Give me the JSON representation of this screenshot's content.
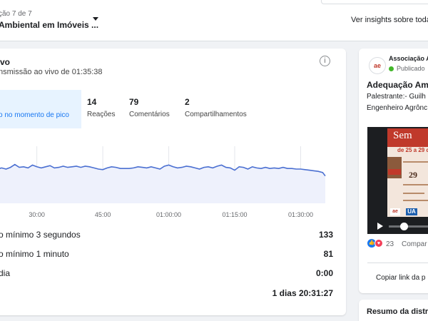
{
  "header": {
    "subtitle": "ção 7 de 7",
    "title": "Ambiental em Imóveis ...",
    "insights_link": "Ver insights sobre toda"
  },
  "live": {
    "title": "vo",
    "subtitle": "nsmissão ao vivo de 01:35:38",
    "peak_label": "o no momento de pico",
    "stats": [
      {
        "value": "14",
        "label": "Reações"
      },
      {
        "value": "79",
        "label": "Comentários"
      },
      {
        "value": "2",
        "label": "Compartilhamentos"
      }
    ],
    "chart_data": {
      "type": "area",
      "x_tick_labels": [
        "30:00",
        "45:00",
        "01:00:00",
        "01:15:00",
        "01:30:00"
      ],
      "x_ticks_minutes": [
        30,
        45,
        60,
        75,
        90
      ],
      "x_range_minutes": [
        20,
        95.6
      ],
      "y_range": [
        0,
        100
      ],
      "series": [
        {
          "x": [
            20,
            21,
            22,
            23,
            24,
            25,
            26,
            27,
            28,
            29,
            30,
            31,
            32,
            33,
            34,
            35,
            36,
            37,
            38,
            39,
            40,
            41,
            42,
            43,
            44,
            45,
            46,
            47,
            48,
            49,
            50,
            51,
            52,
            53,
            54,
            55,
            56,
            57,
            58,
            59,
            60,
            61,
            62,
            63,
            64,
            65,
            66,
            67,
            68,
            69,
            70,
            71,
            72,
            73,
            74,
            75,
            76,
            77,
            78,
            79,
            80,
            81,
            82,
            83,
            84,
            85,
            86,
            87,
            88,
            89,
            90,
            91,
            92,
            93,
            94,
            95,
            95.6
          ],
          "values": [
            58,
            60,
            62,
            60,
            63,
            68,
            63,
            64,
            62,
            67,
            64,
            62,
            64,
            66,
            62,
            63,
            65,
            63,
            64,
            65,
            63,
            65,
            64,
            62,
            60,
            59,
            62,
            64,
            63,
            61,
            61,
            61,
            62,
            64,
            63,
            62,
            64,
            62,
            60,
            65,
            67,
            64,
            62,
            63,
            65,
            64,
            62,
            60,
            63,
            64,
            62,
            65,
            67,
            63,
            62,
            58,
            64,
            63,
            60,
            64,
            62,
            61,
            63,
            61,
            62,
            61,
            63,
            61,
            61,
            60,
            60,
            59,
            58,
            57,
            56,
            54,
            48
          ]
        }
      ],
      "grid": "vertical",
      "colors": {
        "line": "#4a6fd1",
        "fill": "#eef1fc"
      }
    },
    "rows": [
      {
        "label": "o mínimo 3 segundos",
        "value": "133"
      },
      {
        "label": "o mínimo 1 minuto",
        "value": "81"
      },
      {
        "label": "dia",
        "value": "0:00"
      }
    ],
    "total": "1 dias 20:31:27"
  },
  "post": {
    "author": "Associação A",
    "status": "Publicado",
    "title": "Adequação Amb",
    "lines": [
      "Palestrante:- Guilh",
      "Engenheiro Agrônc"
    ],
    "avatar_text": "ae",
    "poster": {
      "heading": "Sem",
      "date": "de 25 a 29 d",
      "number": "29",
      "logo1": "ae",
      "logo2": "UA"
    },
    "reaction_count": "23",
    "share_label": "Compar",
    "copy_link": "Copiar link da p"
  },
  "summary": {
    "title": "Resumo da distr"
  },
  "colors": {
    "accent": "#1877f2",
    "online": "#42b72a",
    "poster_red": "#c0392b"
  }
}
